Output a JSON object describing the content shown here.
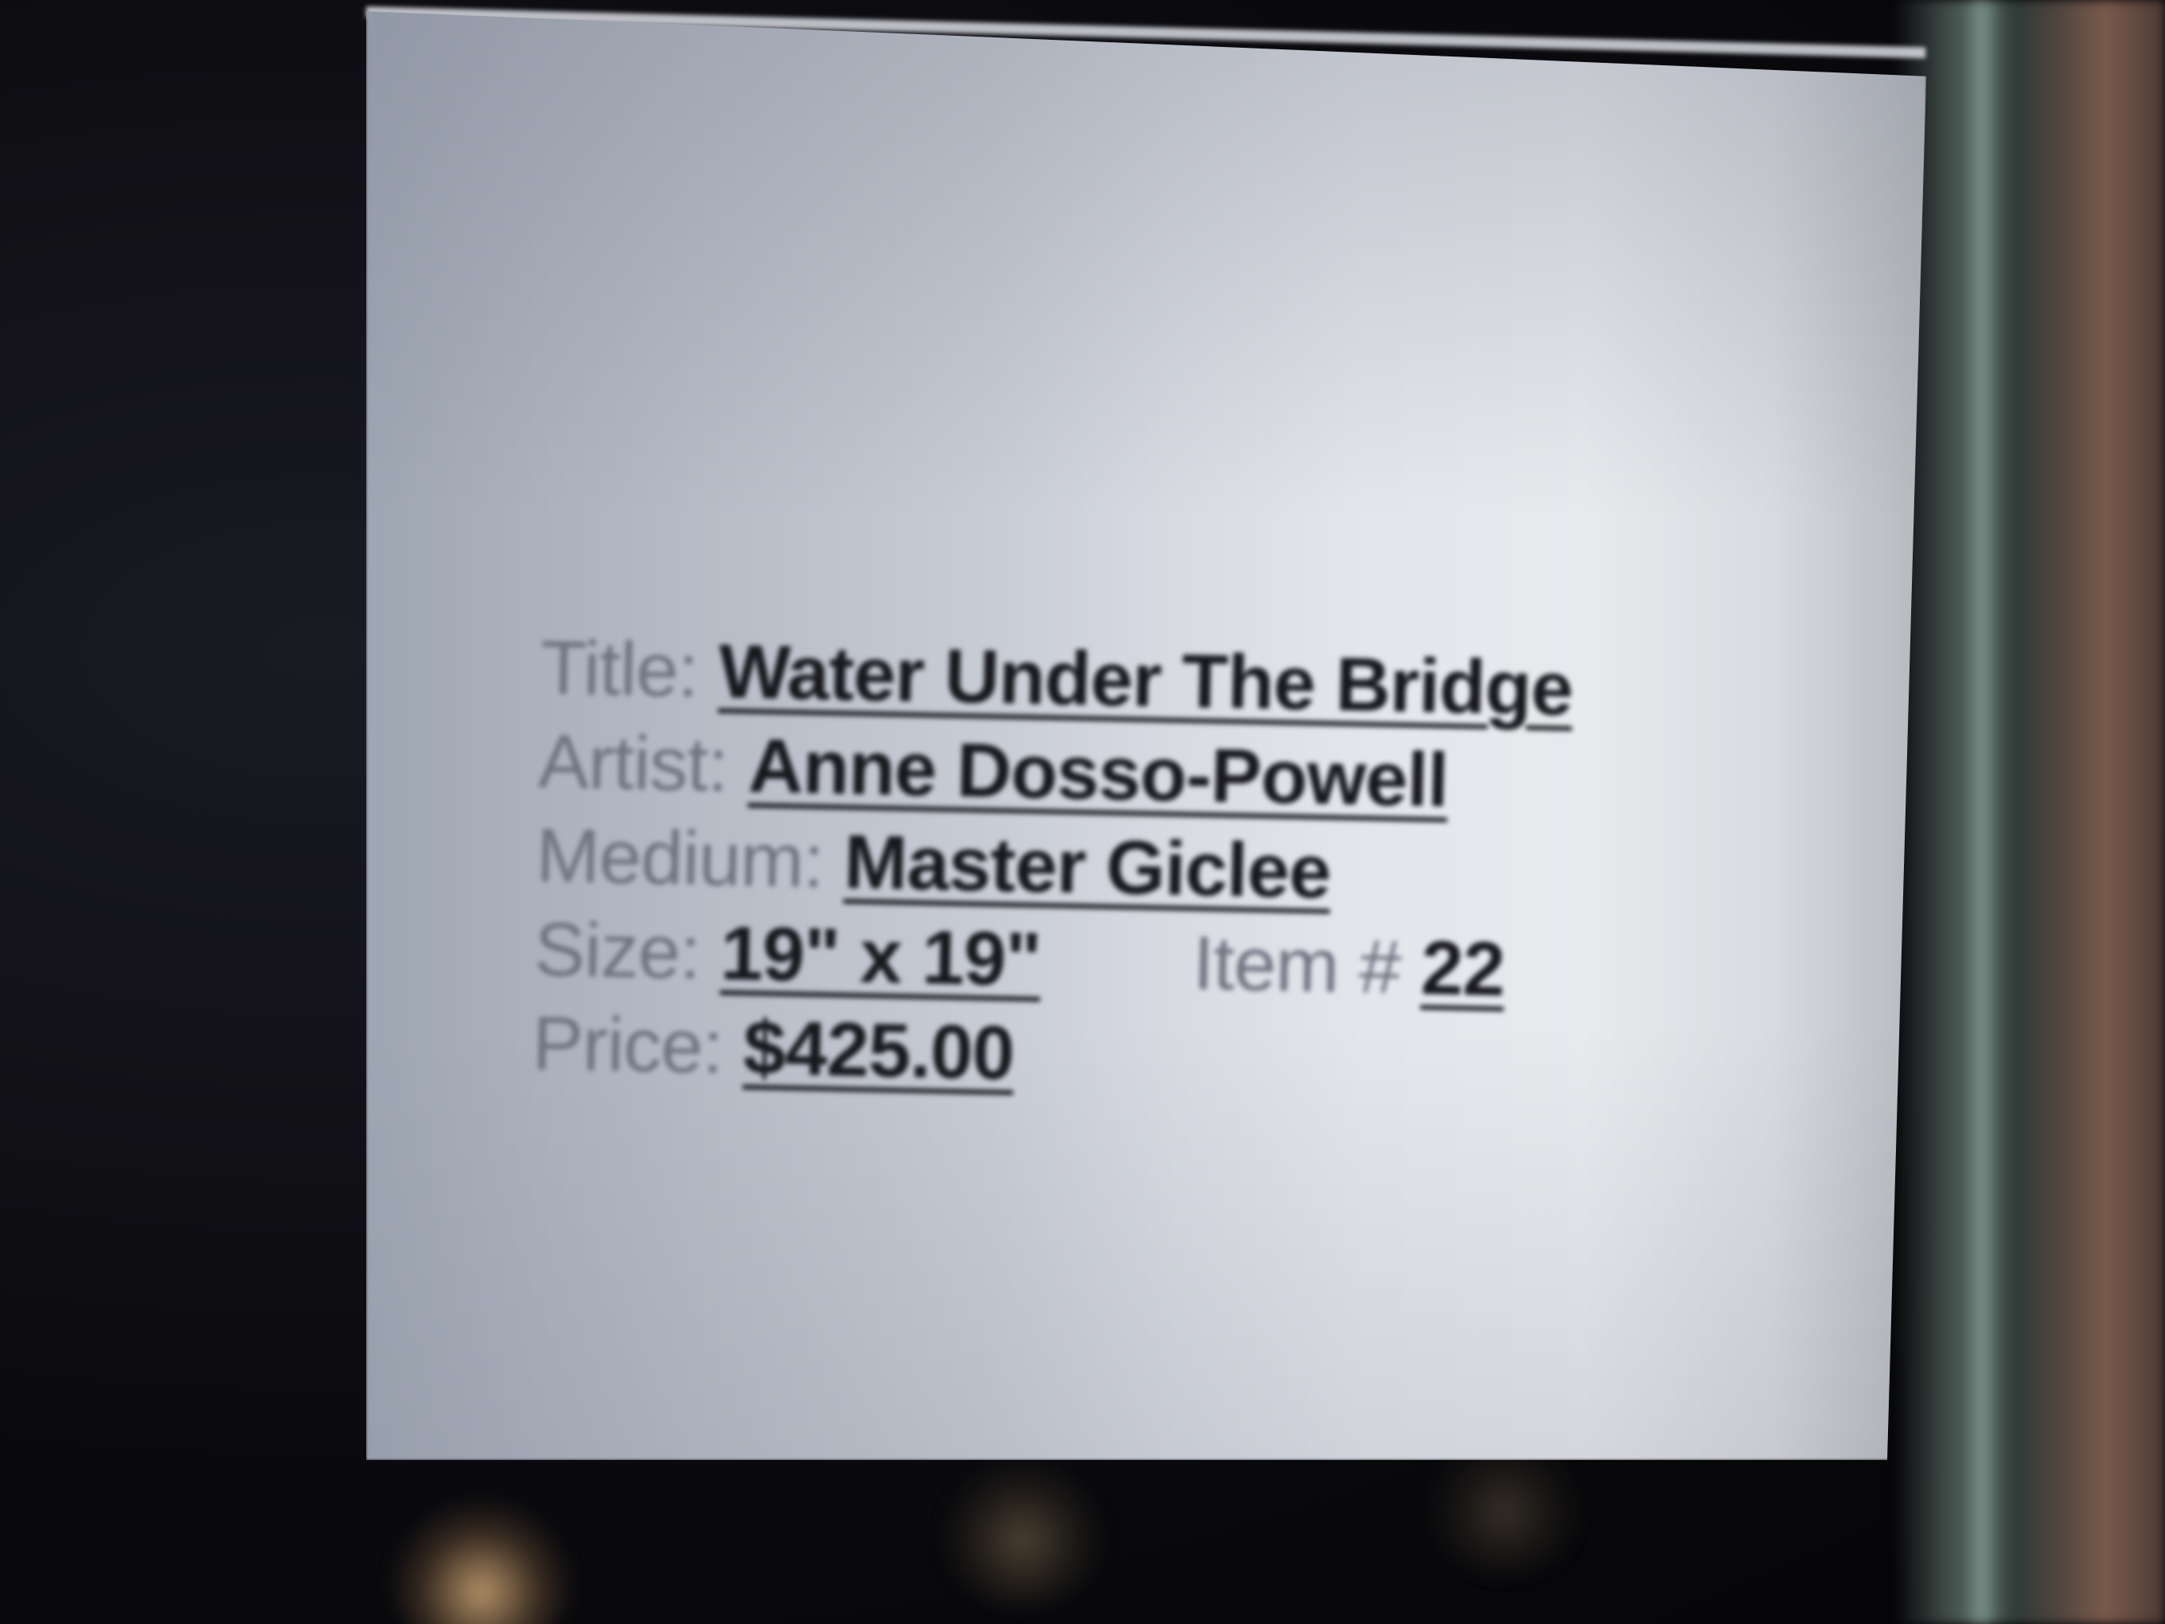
{
  "label": {
    "title_label": "Title:",
    "title_value": "Water Under The Bridge",
    "artist_label": "Artist:",
    "artist_value": "Anne Dosso-Powell",
    "medium_label": "Medium:",
    "medium_value": "Master Giclee",
    "size_label": "Size:",
    "size_value": "19\" x 19\"",
    "item_label": "Item #",
    "item_value": "22",
    "price_label": "Price:",
    "price_value": "$425.00"
  },
  "colors": {
    "card": "#e4e6ec",
    "label_key": "#6e7280",
    "label_value": "#17181d",
    "background": "#0c0c10"
  }
}
